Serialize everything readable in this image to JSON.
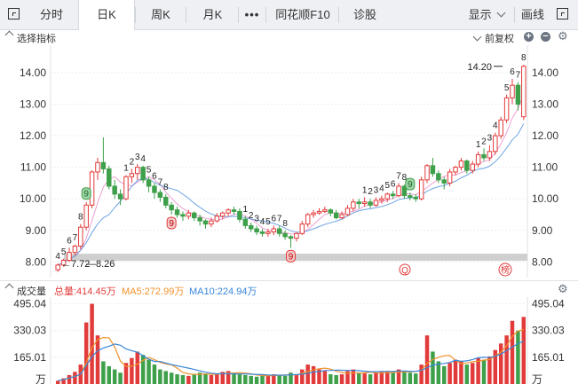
{
  "tabs": {
    "fenshi": "分时",
    "rik": "日K",
    "zhouk": "周K",
    "yuek": "月K",
    "more": "•••",
    "f10": "同花顺F10",
    "zhengu": "诊股",
    "display": "显示",
    "drawline": "画线"
  },
  "main_panel": {
    "indicator_label": "选择指标",
    "fq_label": "前复权",
    "high_label": "14.20",
    "low_label": "7.72",
    "overlap_label": "8.26",
    "marker_q": "Q",
    "marker_bang": "榜"
  },
  "volume_panel": {
    "title": "成交量",
    "total": "总量:414.45万",
    "ma5": "MA5:272.99万",
    "ma10": "MA10:224.94万",
    "unit": "万"
  },
  "colors": {
    "up": "#e23b3b",
    "down": "#3ea04a",
    "ma5": "#f0922b",
    "ma10": "#3a86d8",
    "ma_price_pink": "#e889c8",
    "ma_price_blue": "#4a8fdb"
  },
  "chart_data": [
    {
      "type": "candlestick",
      "title": "",
      "ylim": [
        7.7,
        14.7
      ],
      "y_ticks": [
        "14.00",
        "13.00",
        "12.00",
        "11.00",
        "10.00",
        "9.00",
        "8.00"
      ],
      "tick_values": [
        14,
        13,
        12,
        11,
        10,
        9,
        8
      ],
      "candles": [
        [
          7.75,
          7.9,
          7.68,
          7.95
        ],
        [
          7.9,
          8.05,
          7.85,
          8.1
        ],
        [
          8.05,
          8.3,
          8.0,
          8.45
        ],
        [
          8.3,
          8.5,
          8.2,
          8.55
        ],
        [
          8.5,
          9.1,
          8.4,
          9.2
        ],
        [
          9.1,
          9.8,
          9.0,
          9.9
        ],
        [
          9.8,
          10.85,
          9.7,
          10.9
        ],
        [
          10.85,
          11.15,
          10.6,
          11.3
        ],
        [
          11.15,
          10.95,
          10.8,
          11.95
        ],
        [
          10.95,
          10.4,
          10.3,
          11.05
        ],
        [
          10.4,
          10.15,
          10.0,
          10.6
        ],
        [
          10.15,
          10.0,
          9.8,
          10.3
        ],
        [
          10.0,
          10.7,
          9.95,
          10.75
        ],
        [
          10.7,
          10.8,
          10.5,
          10.95
        ],
        [
          10.8,
          11.0,
          10.6,
          11.1
        ],
        [
          11.0,
          10.6,
          10.5,
          11.05
        ],
        [
          10.6,
          10.4,
          10.2,
          10.7
        ],
        [
          10.4,
          10.2,
          10.0,
          10.5
        ],
        [
          10.2,
          10.05,
          9.9,
          10.3
        ],
        [
          10.05,
          9.8,
          9.7,
          10.15
        ],
        [
          9.8,
          9.65,
          9.5,
          9.9
        ],
        [
          9.65,
          9.5,
          9.4,
          9.75
        ],
        [
          9.5,
          9.45,
          9.3,
          9.6
        ],
        [
          9.45,
          9.55,
          9.35,
          9.65
        ],
        [
          9.55,
          9.4,
          9.3,
          9.6
        ],
        [
          9.4,
          9.3,
          9.15,
          9.5
        ],
        [
          9.3,
          9.2,
          9.05,
          9.35
        ],
        [
          9.2,
          9.3,
          9.1,
          9.4
        ],
        [
          9.3,
          9.45,
          9.25,
          9.55
        ],
        [
          9.45,
          9.55,
          9.35,
          9.6
        ],
        [
          9.55,
          9.65,
          9.45,
          9.7
        ],
        [
          9.65,
          9.6,
          9.5,
          9.75
        ],
        [
          9.6,
          9.35,
          9.25,
          9.7
        ],
        [
          9.35,
          9.15,
          9.05,
          9.45
        ],
        [
          9.15,
          9.05,
          8.95,
          9.25
        ],
        [
          9.05,
          8.95,
          8.85,
          9.15
        ],
        [
          8.95,
          8.9,
          8.8,
          9.05
        ],
        [
          8.9,
          8.95,
          8.8,
          9.05
        ],
        [
          8.95,
          9.05,
          8.85,
          9.15
        ],
        [
          9.05,
          8.9,
          8.8,
          9.15
        ],
        [
          8.9,
          8.8,
          8.7,
          9.0
        ],
        [
          8.8,
          8.75,
          8.45,
          8.85
        ],
        [
          8.75,
          8.9,
          8.65,
          8.95
        ],
        [
          8.9,
          9.2,
          8.85,
          9.3
        ],
        [
          9.2,
          9.5,
          9.1,
          9.55
        ],
        [
          9.5,
          9.55,
          9.4,
          9.65
        ],
        [
          9.55,
          9.6,
          9.5,
          9.7
        ],
        [
          9.6,
          9.65,
          9.55,
          9.75
        ],
        [
          9.65,
          9.55,
          9.45,
          9.7
        ],
        [
          9.55,
          9.4,
          9.35,
          9.65
        ],
        [
          9.4,
          9.5,
          9.35,
          9.6
        ],
        [
          9.5,
          9.7,
          9.45,
          9.8
        ],
        [
          9.7,
          9.9,
          9.6,
          10.0
        ],
        [
          9.9,
          9.85,
          9.7,
          10.0
        ],
        [
          9.85,
          9.9,
          9.75,
          10.05
        ],
        [
          9.9,
          9.8,
          9.7,
          10.0
        ],
        [
          9.8,
          9.95,
          9.75,
          10.05
        ],
        [
          9.95,
          10.0,
          9.85,
          10.1
        ],
        [
          10.0,
          10.15,
          9.9,
          10.2
        ],
        [
          10.15,
          10.1,
          10.0,
          10.25
        ],
        [
          10.1,
          10.4,
          10.05,
          10.5
        ],
        [
          10.4,
          10.1,
          10.0,
          10.45
        ],
        [
          10.1,
          10.05,
          9.95,
          10.2
        ],
        [
          10.05,
          10.0,
          9.9,
          10.15
        ],
        [
          10.0,
          10.6,
          9.95,
          10.7
        ],
        [
          10.6,
          11.05,
          10.5,
          11.1
        ],
        [
          11.05,
          10.8,
          10.7,
          11.3
        ],
        [
          10.8,
          10.6,
          10.5,
          10.9
        ],
        [
          10.6,
          10.5,
          10.3,
          10.7
        ],
        [
          10.5,
          10.85,
          10.4,
          10.95
        ],
        [
          10.85,
          11.0,
          10.75,
          11.05
        ],
        [
          11.0,
          11.2,
          10.9,
          11.3
        ],
        [
          11.2,
          10.9,
          10.8,
          11.25
        ],
        [
          10.9,
          11.1,
          10.8,
          11.2
        ],
        [
          11.1,
          11.4,
          11.0,
          11.5
        ],
        [
          11.4,
          11.3,
          11.2,
          11.6
        ],
        [
          11.3,
          11.5,
          11.2,
          11.7
        ],
        [
          11.5,
          12.0,
          11.4,
          12.1
        ],
        [
          12.0,
          12.5,
          11.9,
          12.6
        ],
        [
          12.5,
          13.2,
          12.4,
          13.3
        ],
        [
          13.2,
          13.6,
          13.0,
          13.8
        ],
        [
          13.6,
          13.0,
          12.8,
          13.7
        ],
        [
          12.6,
          14.2,
          12.5,
          14.25
        ]
      ],
      "annotations": [
        {
          "i": 0,
          "t": "4"
        },
        {
          "i": 1,
          "t": "5"
        },
        {
          "i": 2,
          "t": "6"
        },
        {
          "i": 3,
          "t": "7"
        },
        {
          "i": 4,
          "t": "8"
        },
        {
          "i": 5,
          "t": "9",
          "badge": "green"
        },
        {
          "i": 12,
          "t": "1"
        },
        {
          "i": 13,
          "t": "2"
        },
        {
          "i": 14,
          "t": "3"
        },
        {
          "i": 15,
          "t": "4"
        },
        {
          "i": 16,
          "t": "5"
        },
        {
          "i": 17,
          "t": "6"
        },
        {
          "i": 18,
          "t": "7"
        },
        {
          "i": 19,
          "t": "8"
        },
        {
          "i": 20,
          "t": "9",
          "badge": "red"
        },
        {
          "i": 33,
          "t": "1"
        },
        {
          "i": 34,
          "t": "2"
        },
        {
          "i": 35,
          "t": "3"
        },
        {
          "i": 36,
          "t": "4"
        },
        {
          "i": 37,
          "t": "5"
        },
        {
          "i": 38,
          "t": "6"
        },
        {
          "i": 39,
          "t": "7"
        },
        {
          "i": 40,
          "t": "8"
        },
        {
          "i": 41,
          "t": "9",
          "badge": "red"
        },
        {
          "i": 54,
          "t": "1"
        },
        {
          "i": 55,
          "t": "2"
        },
        {
          "i": 56,
          "t": "3"
        },
        {
          "i": 57,
          "t": "4"
        },
        {
          "i": 58,
          "t": "5"
        },
        {
          "i": 59,
          "t": "6"
        },
        {
          "i": 60,
          "t": "7"
        },
        {
          "i": 61,
          "t": "8"
        },
        {
          "i": 62,
          "t": "9",
          "badge": "green"
        },
        {
          "i": 74,
          "t": "1"
        },
        {
          "i": 75,
          "t": "2"
        },
        {
          "i": 76,
          "t": "3"
        },
        {
          "i": 77,
          "t": "4"
        },
        {
          "i": 79,
          "t": "5"
        },
        {
          "i": 80,
          "t": "6"
        },
        {
          "i": 81,
          "t": "7"
        },
        {
          "i": 82,
          "t": "8"
        }
      ]
    },
    {
      "type": "bar",
      "title": "成交量",
      "ylim": [
        0,
        520
      ],
      "y_ticks": [
        "495.04",
        "330.03",
        "165.01"
      ],
      "tick_values": [
        495.04,
        330.03,
        165.01
      ],
      "values": [
        20,
        35,
        55,
        75,
        120,
        380,
        495,
        300,
        140,
        110,
        90,
        70,
        130,
        160,
        200,
        180,
        150,
        120,
        90,
        80,
        70,
        60,
        55,
        50,
        60,
        70,
        65,
        55,
        60,
        75,
        80,
        70,
        60,
        55,
        50,
        45,
        50,
        55,
        60,
        55,
        50,
        70,
        60,
        90,
        120,
        110,
        90,
        80,
        60,
        55,
        60,
        80,
        90,
        70,
        65,
        60,
        70,
        75,
        80,
        70,
        90,
        80,
        70,
        65,
        120,
        300,
        200,
        140,
        110,
        130,
        150,
        140,
        120,
        130,
        160,
        150,
        170,
        210,
        250,
        300,
        390,
        330,
        414
      ],
      "ma5": [
        20,
        28,
        37,
        46,
        61,
        133,
        225,
        274,
        287,
        285,
        228,
        142,
        108,
        110,
        122,
        146,
        164,
        150,
        134,
        124,
        118,
        98,
        71,
        63,
        59,
        60,
        62,
        60,
        60,
        65,
        67,
        68,
        70,
        66,
        63,
        56,
        52,
        51,
        52,
        53,
        54,
        58,
        56,
        67,
        77,
        88,
        94,
        98,
        92,
        79,
        71,
        67,
        69,
        67,
        69,
        73,
        69,
        68,
        70,
        71,
        72,
        75,
        76,
        77,
        85,
        127,
        151,
        165,
        174,
        176,
        146,
        126,
        130,
        138,
        140,
        148,
        151,
        173,
        196,
        236,
        294,
        326,
        337
      ],
      "ma10": [
        20,
        28,
        37,
        46,
        61,
        115,
        169,
        205,
        222,
        233,
        247,
        239,
        217,
        206,
        196,
        174,
        153,
        139,
        139,
        129,
        120,
        112,
        105,
        98,
        90,
        81,
        73,
        67,
        63,
        65,
        63,
        63,
        62,
        62,
        61,
        59,
        58,
        56,
        55,
        55,
        55,
        57,
        58,
        61,
        66,
        74,
        78,
        83,
        84,
        86,
        85,
        84,
        84,
        82,
        79,
        76,
        76,
        78,
        78,
        78,
        80,
        80,
        79,
        78,
        85,
        101,
        115,
        123,
        127,
        133,
        146,
        140,
        143,
        151,
        162,
        165,
        163,
        171,
        185,
        206,
        228,
        249,
        264
      ]
    }
  ]
}
